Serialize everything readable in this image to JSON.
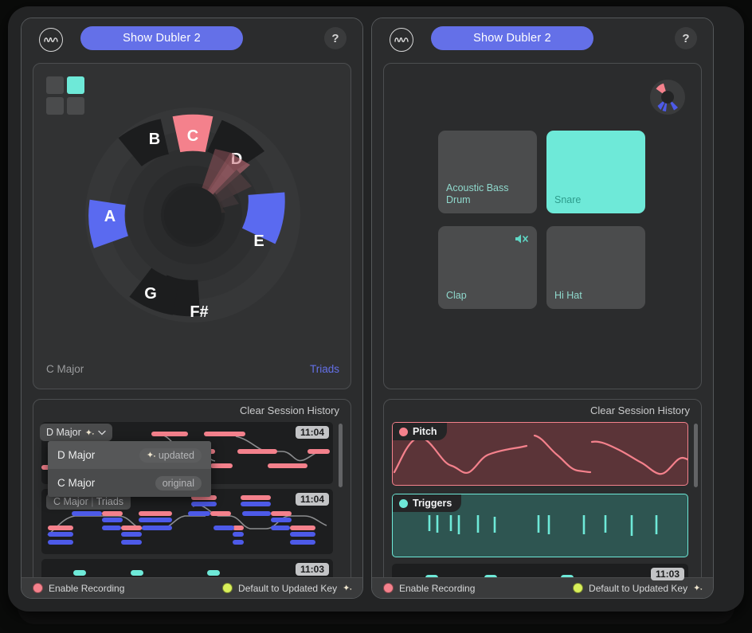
{
  "window": {
    "background": "#232425",
    "panel_bg": "#2b2c2d"
  },
  "colors": {
    "accent_blue": "#6470e8",
    "accent_teal": "#6ee9d8",
    "accent_red": "#f4818c",
    "led_red": "#f4818c",
    "led_yellow": "#d8ef5a",
    "card_bg": "#313233",
    "pad_bg": "#4b4c4d"
  },
  "panels": [
    {
      "id": "left-panel",
      "header": {
        "logo_icon": "waveform-circle-icon",
        "show_button_label": "Show Dubler 2",
        "help_button_label": "?"
      },
      "view": "chord-wheel",
      "grid_icon": {
        "name": "pad-grid-icon",
        "active_cell": 1
      },
      "wheel": {
        "segments": [
          {
            "label": "C",
            "state": "active-red"
          },
          {
            "label": "D",
            "state": "inactive"
          },
          {
            "label": "E",
            "state": "active-blue"
          },
          {
            "label": "F#",
            "state": "inactive"
          },
          {
            "label": "G",
            "state": "inactive"
          },
          {
            "label": "A",
            "state": "active-blue"
          },
          {
            "label": "B",
            "state": "inactive"
          }
        ],
        "key_label": "C Major",
        "mode_label": "Triads"
      },
      "history": {
        "clear_label": "Clear Session History",
        "dropdown": {
          "selected": "D Major",
          "selected_icon": "sparkle-icon",
          "chevron": "chevron-down-icon",
          "open": true,
          "options": [
            {
              "label": "D Major",
              "badge": "updated",
              "badge_icon": "sparkle-icon",
              "selected": true
            },
            {
              "label": "C Major",
              "badge": "original",
              "badge_icon": "",
              "selected": false
            }
          ]
        },
        "rows": [
          {
            "time": "11:04",
            "tag": "",
            "kind": "melody"
          },
          {
            "time": "11:04",
            "tag": "C Major | Triads",
            "tag_key": "C Major",
            "tag_mode": "Triads",
            "kind": "chords"
          },
          {
            "time": "11:03",
            "tag": "",
            "kind": "triggers"
          }
        ]
      },
      "statusbar": {
        "record_label": "Enable Recording",
        "record_led": "#f4818c",
        "key_label": "Default to Updated Key",
        "key_led": "#d8ef5a",
        "key_icon": "sparkle-icon"
      }
    },
    {
      "id": "right-panel",
      "header": {
        "logo_icon": "waveform-circle-icon",
        "show_button_label": "Show Dubler 2",
        "help_button_label": "?"
      },
      "view": "drum-pads",
      "mini_donut_icon": "chord-wheel-mini-icon",
      "pads": [
        {
          "label": "Acoustic Bass Drum",
          "active": false,
          "muted": false
        },
        {
          "label": "Snare",
          "active": true,
          "muted": false
        },
        {
          "label": "Clap",
          "active": false,
          "muted": true,
          "mute_icon": "speaker-mute-icon"
        },
        {
          "label": "Hi Hat",
          "active": false,
          "muted": false
        }
      ],
      "history": {
        "clear_label": "Clear Session History",
        "viz": [
          {
            "label": "Pitch",
            "dot_color": "#f4818c",
            "border": "#f4818c",
            "fill": "#5b3438"
          },
          {
            "label": "Triggers",
            "dot_color": "#6ee9d8",
            "border": "#6ee9d8",
            "fill": "#2e5551"
          }
        ],
        "rows": [
          {
            "time": "11:03",
            "kind": "triggers"
          }
        ]
      },
      "statusbar": {
        "record_label": "Enable Recording",
        "record_led": "#f4818c",
        "key_label": "Default to Updated Key",
        "key_led": "#d8ef5a",
        "key_icon": "sparkle-icon"
      }
    }
  ]
}
